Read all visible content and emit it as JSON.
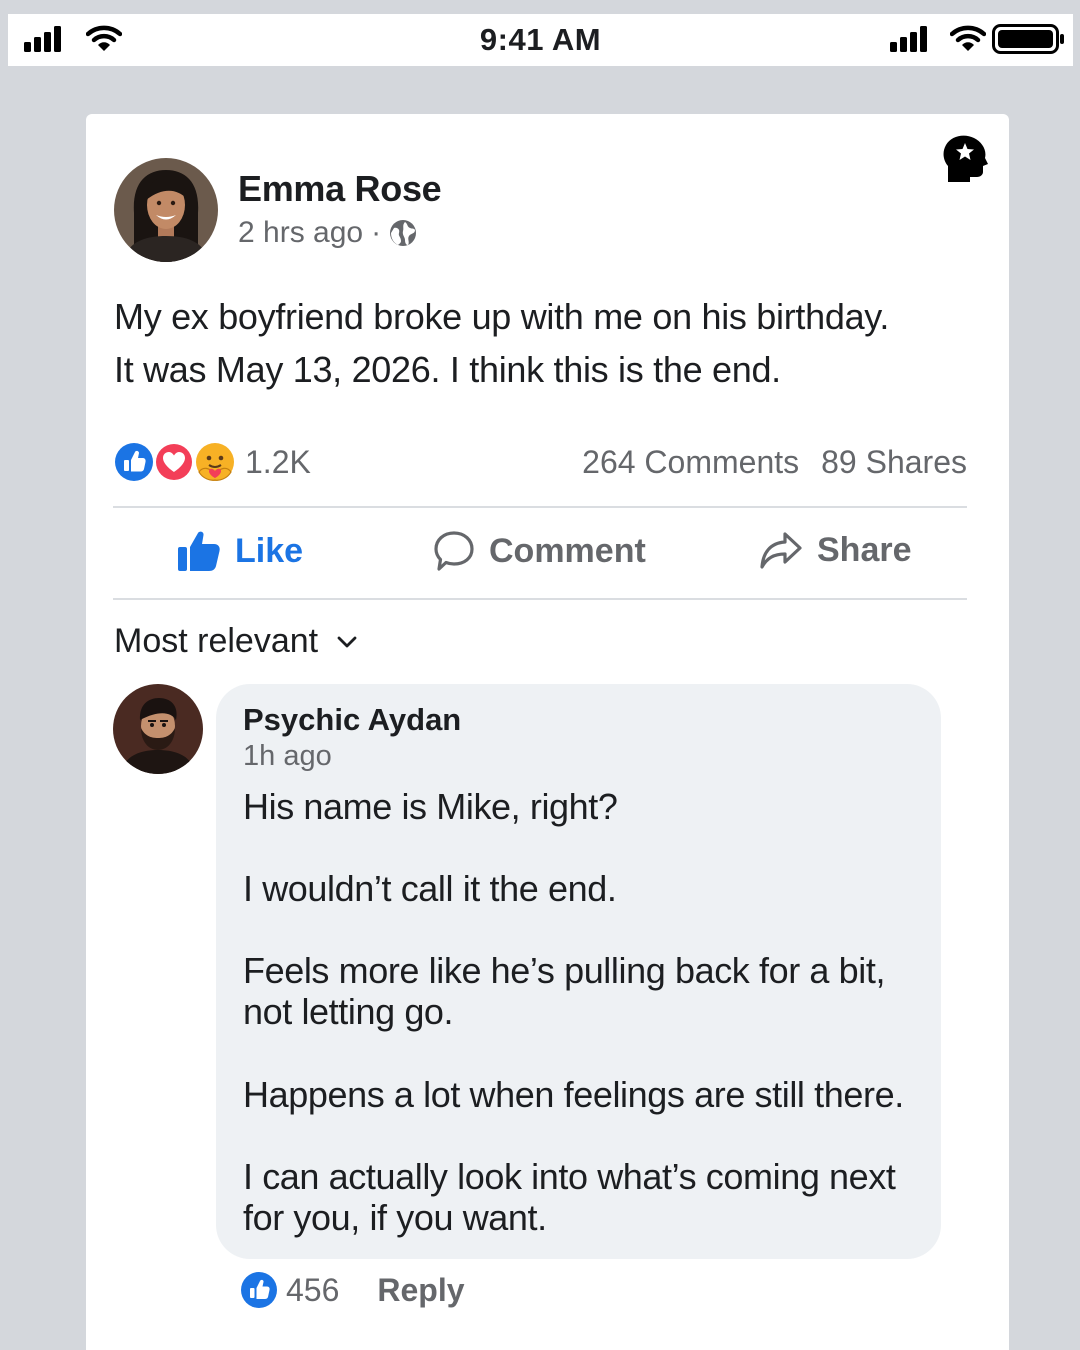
{
  "status_bar": {
    "time": "9:41 AM",
    "icons": [
      "signal-icon",
      "wifi-icon",
      "signal-icon",
      "wifi-icon",
      "battery-icon"
    ]
  },
  "post": {
    "author": "Emma Rose",
    "time": "2 hrs ago",
    "separator": "·",
    "privacy_icon": "globe-icon",
    "text_line_1": "My ex boyfriend broke up with me on his birthday.",
    "text_line_2": "It was May 13, 2026. I think this is the end.",
    "reaction_icons": [
      "like-reaction-icon",
      "love-reaction-icon",
      "care-reaction-icon"
    ],
    "reaction_count": "1.2K",
    "comments_count": "264 Comments",
    "shares_count": "89 Shares"
  },
  "actions": {
    "like": "Like",
    "comment": "Comment",
    "share": "Share"
  },
  "sort": {
    "label": "Most relevant",
    "icon": "chevron-down-icon"
  },
  "comment": {
    "author": "Psychic Aydan",
    "time": "1h ago",
    "lines": [
      "His name is Mike, right?",
      "I wouldn’t call it the end.",
      "Feels more like he’s pulling back for a bit,",
      "not letting go.",
      "Happens a lot when feelings are still there.",
      "I can actually look into what’s coming next",
      "for you, if you want."
    ],
    "like_count": "456",
    "reply": "Reply"
  },
  "colors": {
    "facebook_blue": "#1b74e4",
    "love_red": "#f33e58",
    "muted_text": "#65676b",
    "bubble_bg": "#eef1f4",
    "page_bg": "#d4d7dc"
  }
}
